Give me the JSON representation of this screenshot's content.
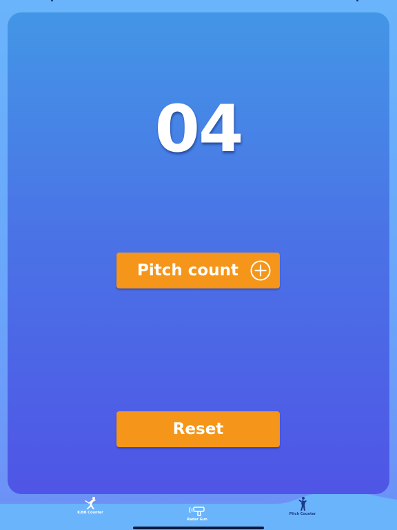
{
  "counter": {
    "value": "04"
  },
  "buttons": {
    "pitch_count_label": "Pitch count",
    "reset_label": "Reset"
  },
  "tabs": [
    {
      "label": "K/BB Counter",
      "icon": "pitcher-throwing-icon"
    },
    {
      "label": "Radar Gun",
      "icon": "radar-gun-icon"
    },
    {
      "label": "Pitch Counter",
      "icon": "pitcher-windup-icon"
    }
  ],
  "active_tab": "Pitch Counter",
  "colors": {
    "button": "#f5961a",
    "card_top": "#4396e6",
    "card_bottom": "#4f55e6",
    "active_tab_icon": "#1c3a86",
    "text": "#ffffff"
  }
}
